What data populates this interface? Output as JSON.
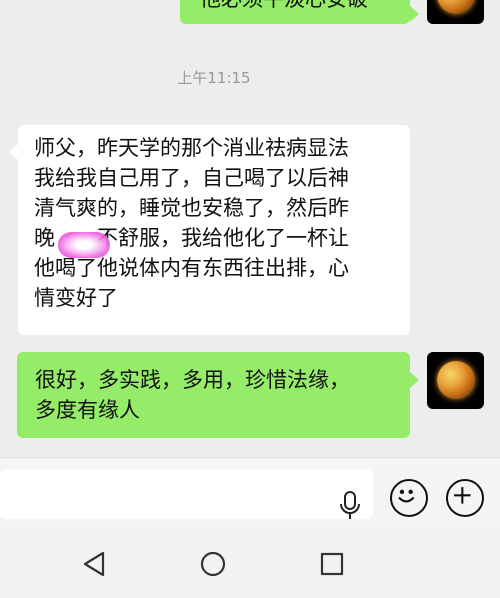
{
  "messages": {
    "top_partial": "他必须平淡心安破",
    "timestamp": "上午11:15",
    "incoming": {
      "lines": [
        "师父，昨天学的那个消业祛病显法",
        "我给我自己用了，自己喝了以后神",
        "清气爽的，睡觉也安稳了，然后昨",
        "晚",
        "不舒服，我给他化了一杯让",
        "他喝了他说体内有东西往出排，心",
        "情变好了"
      ]
    },
    "outgoing": {
      "lines": [
        "很好，多实践，多用，珍惜法缘，",
        "多度有缘人"
      ]
    }
  },
  "icons": {
    "voice": "mic-icon",
    "emoji": "emoji-icon",
    "plus": "plus-icon",
    "back": "back-triangle-icon",
    "home": "home-circle-icon",
    "recent": "recent-square-icon"
  }
}
